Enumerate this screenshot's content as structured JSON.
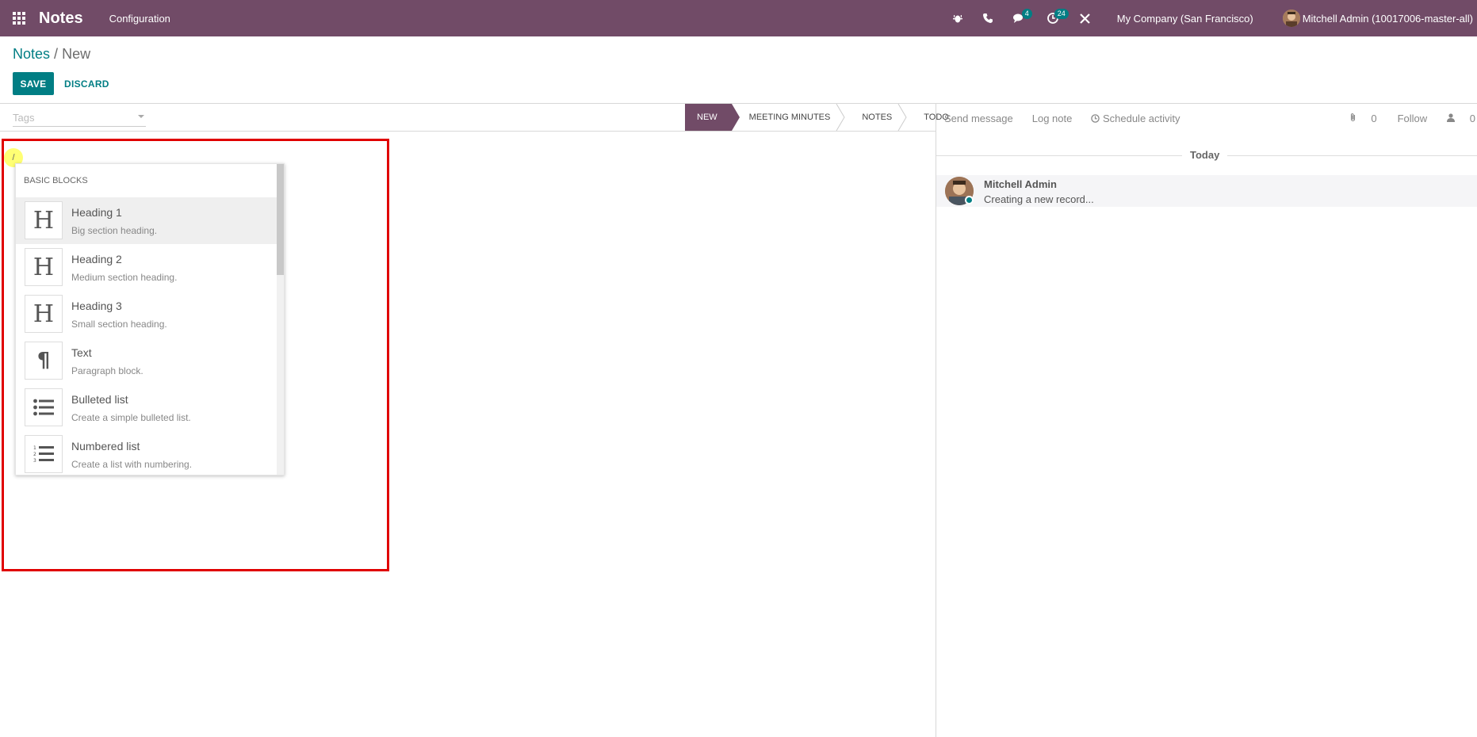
{
  "navbar": {
    "app_name": "Notes",
    "menu": [
      "Configuration"
    ],
    "messages_badge": "4",
    "activities_badge": "24",
    "company": "My Company (San Francisco)",
    "user": "Mitchell Admin (10017006-master-all)"
  },
  "breadcrumb": {
    "parent": "Notes",
    "separator": "/",
    "current": "New"
  },
  "buttons": {
    "save": "SAVE",
    "discard": "DISCARD"
  },
  "tags": {
    "placeholder": "Tags"
  },
  "stages": [
    "NEW",
    "MEETING MINUTES",
    "NOTES",
    "TODO"
  ],
  "active_stage": "NEW",
  "chatter": {
    "send_message": "Send message",
    "log_note": "Log note",
    "schedule_activity": "Schedule activity",
    "attachments_count": "0",
    "follow": "Follow",
    "followers_count": "0",
    "date_separator": "Today",
    "message": {
      "author": "Mitchell Admin",
      "body": "Creating a new record..."
    }
  },
  "editor": {
    "typed_text": "/"
  },
  "powerbox": {
    "category": "BASIC BLOCKS",
    "items": [
      {
        "icon": "heading-icon",
        "glyph": "H",
        "title": "Heading 1",
        "description": "Big section heading."
      },
      {
        "icon": "heading-icon",
        "glyph": "H",
        "title": "Heading 2",
        "description": "Medium section heading."
      },
      {
        "icon": "heading-icon",
        "glyph": "H",
        "title": "Heading 3",
        "description": "Small section heading."
      },
      {
        "icon": "paragraph-icon",
        "glyph": "¶",
        "title": "Text",
        "description": "Paragraph block."
      },
      {
        "icon": "bulleted-list-icon",
        "glyph": "",
        "title": "Bulleted list",
        "description": "Create a simple bulleted list."
      },
      {
        "icon": "numbered-list-icon",
        "glyph": "",
        "title": "Numbered list",
        "description": "Create a list with numbering."
      }
    ]
  },
  "colors": {
    "brand": "#714B67",
    "accent": "#017e84",
    "highlight": "#e00000"
  }
}
